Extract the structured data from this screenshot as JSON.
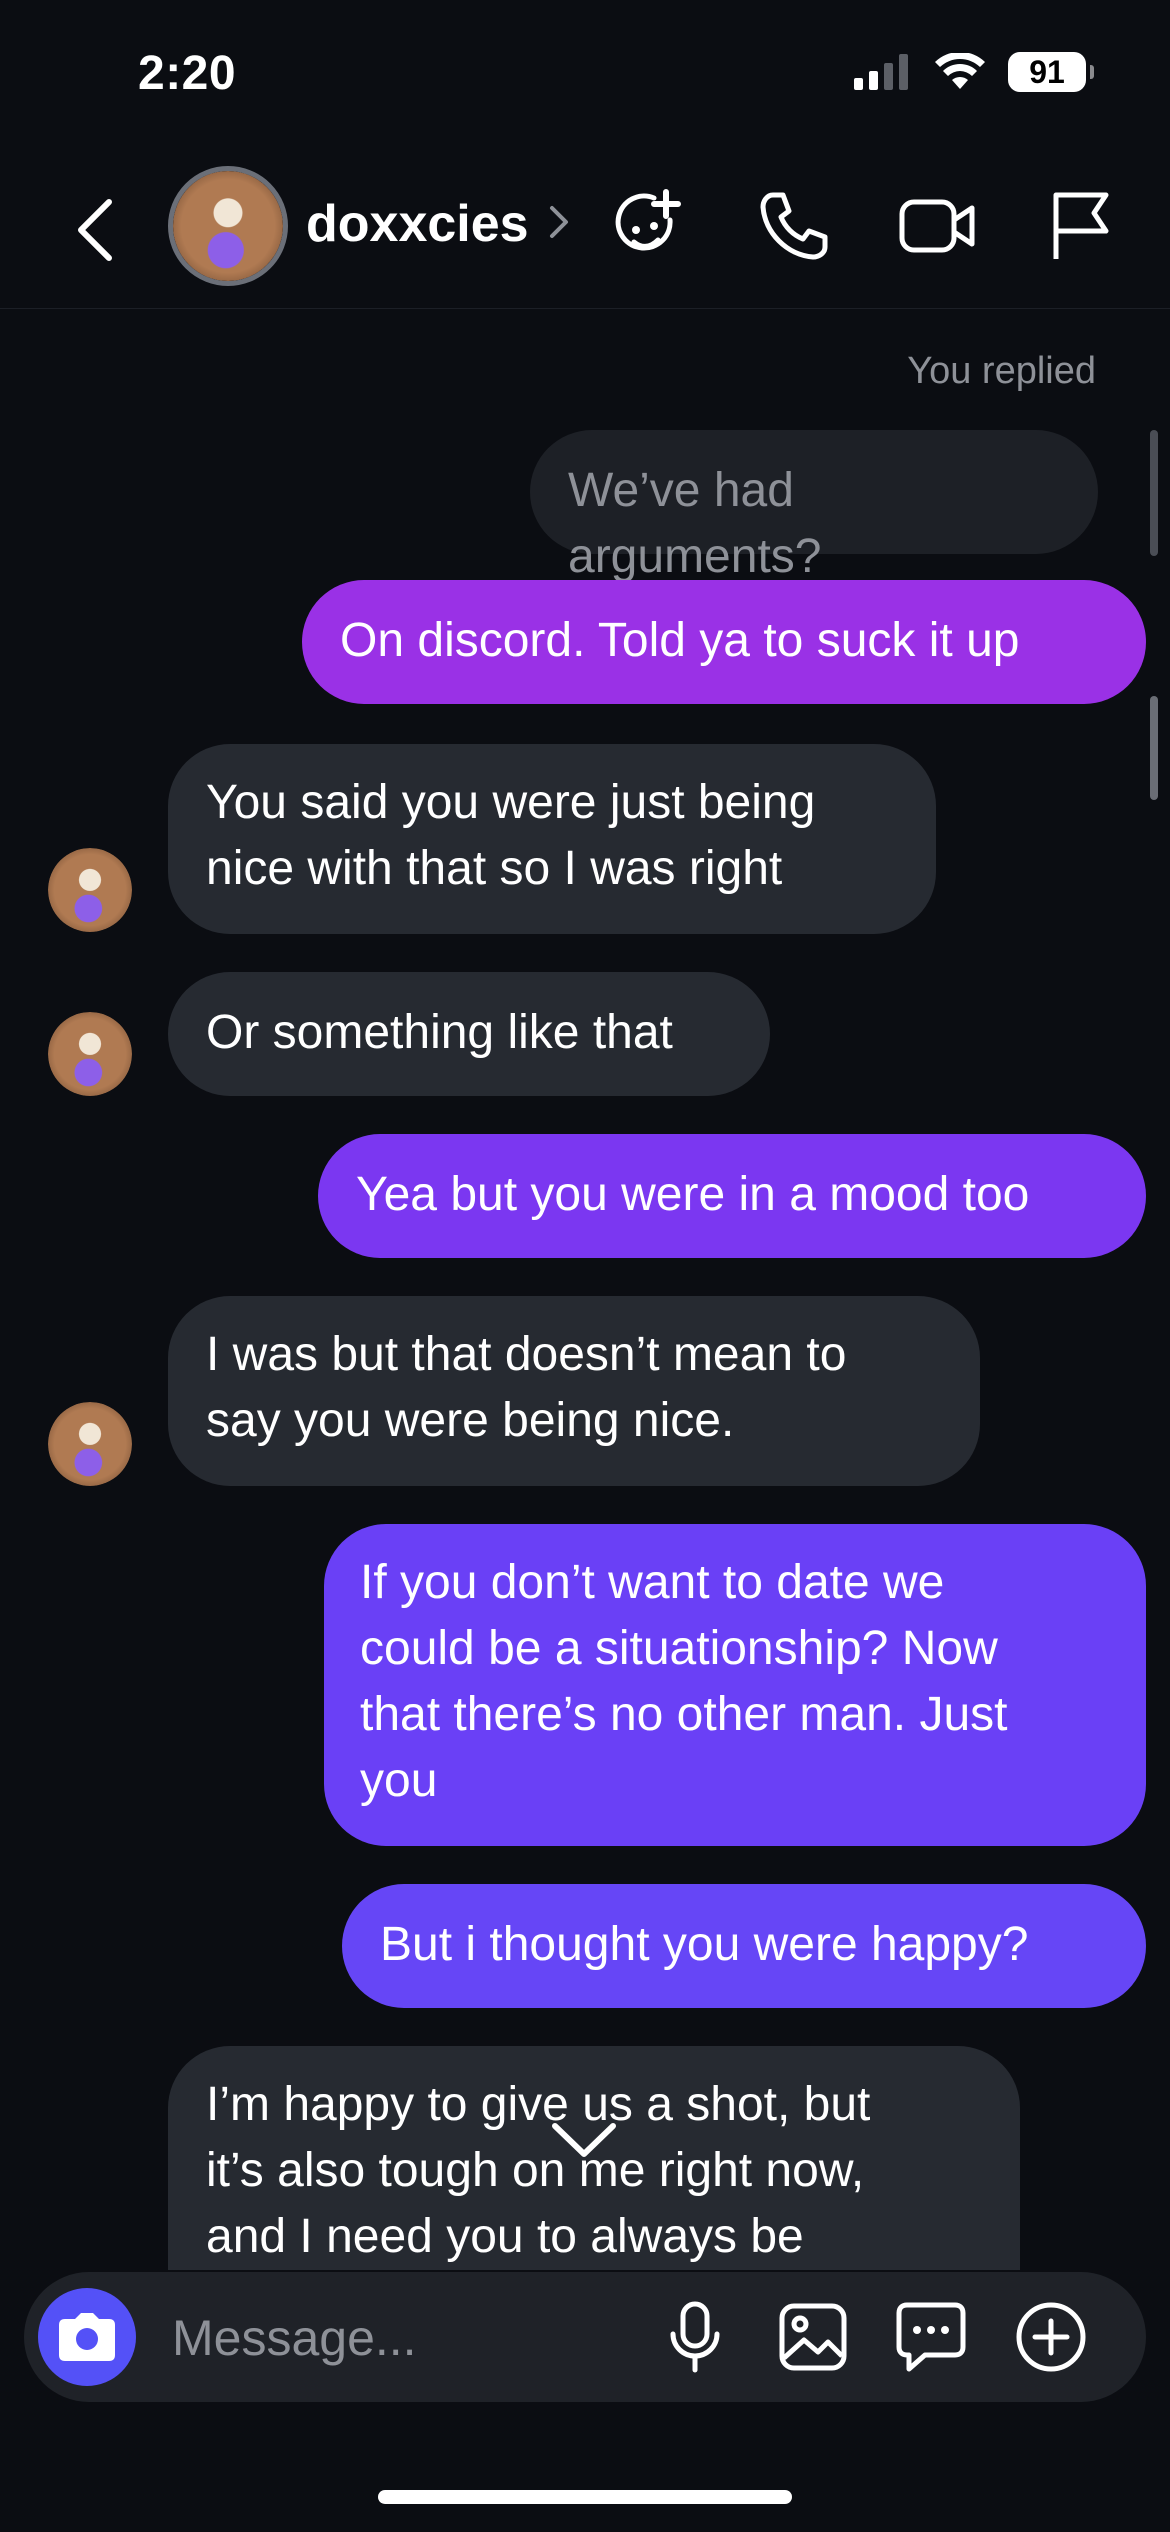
{
  "status_bar": {
    "time": "2:20",
    "battery": "91"
  },
  "header": {
    "username": "doxxcies"
  },
  "conversation": {
    "replied_label": "You replied",
    "quoted_message": "We’ve had arguments?",
    "messages": [
      {
        "from": "me",
        "text": "On discord. Told ya to suck it up",
        "color": "#9a31e6"
      },
      {
        "from": "them",
        "lines": [
          "You said you were just being",
          "nice with that so I was right"
        ]
      },
      {
        "from": "them",
        "text": "Or something like that"
      },
      {
        "from": "me",
        "text": "Yea but you were in a mood too",
        "color": "#7b37f1"
      },
      {
        "from": "them",
        "lines": [
          "I was but that doesn’t mean to",
          "say you were being nice."
        ]
      },
      {
        "from": "me",
        "lines": [
          "If you don’t want to date we",
          "could be a situationship? Now",
          "that there’s no other man. Just",
          "you"
        ],
        "color": "#6a40f6"
      },
      {
        "from": "me",
        "text": "But i thought you were happy?",
        "color": "#6646f6"
      },
      {
        "from": "them",
        "lines": [
          "I’m happy to give us a shot, but",
          "it’s also tough on me right now,",
          "and I need you to always be"
        ]
      }
    ]
  },
  "composer": {
    "placeholder": "Message..."
  },
  "colors": {
    "background": "#0b0d12",
    "incoming_bubble": "#262a31",
    "camera_button": "#5451f7"
  },
  "icons": [
    "back-chevron-icon",
    "chevron-right-icon",
    "add-sticker-icon",
    "phone-icon",
    "video-camera-icon",
    "flag-icon",
    "camera-icon",
    "microphone-icon",
    "gallery-icon",
    "chat-bubble-icon",
    "plus-circle-icon",
    "chevron-down-icon"
  ]
}
